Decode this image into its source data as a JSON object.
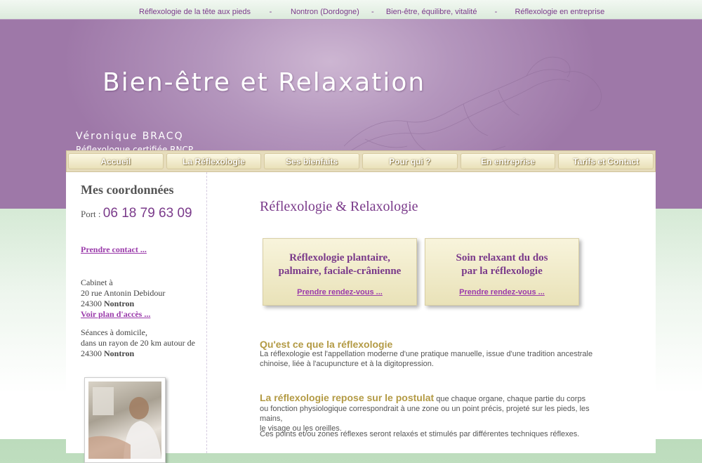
{
  "topnav": [
    {
      "label": "Réflexologie de la tête aux pieds"
    },
    {
      "label": "Nontron (Dordogne)"
    },
    {
      "label": "Bien-être, équilibre, vitalité"
    },
    {
      "label": "Réflexologie en entreprise"
    }
  ],
  "topnav_separator": "-",
  "banner": {
    "title": "Bien-être et Relaxation",
    "name": "Véronique BRACQ",
    "subtitle": "Réflexologue certifiée RNCP"
  },
  "menu": [
    {
      "label": "Accueil"
    },
    {
      "label": "La Réflexologie"
    },
    {
      "label": "Ses bienfaits"
    },
    {
      "label": "Pour qui ?"
    },
    {
      "label": "En entreprise"
    },
    {
      "label": "Tarifs et Contact"
    }
  ],
  "sidebar": {
    "title": "Mes coordonnées",
    "port_label": "Port :",
    "phone": "06 18 79 63 09",
    "contact_link": "Prendre contact ...",
    "address_line1": "Cabinet à",
    "address_line2": "20 rue Antonin Debidour",
    "postcode": "24300",
    "city": "Nontron",
    "map_link": "Voir plan d'accès ...",
    "home_line1": "Séances à domicile,",
    "home_line2": "dans un rayon de 20 km autour de",
    "home_postcode": "24300",
    "home_city": "Nontron"
  },
  "main": {
    "title": "Réflexologie & Relaxologie",
    "cards": [
      {
        "line1": "Réflexologie plantaire,",
        "line2": "palmaire, faciale-crânienne",
        "link": "Prendre rendez-vous ..."
      },
      {
        "line1": "Soin relaxant du dos",
        "line2": "par la réflexologie",
        "link": "Prendre rendez-vous ..."
      }
    ],
    "section1": {
      "heading": "Qu'est ce que la réflexologie",
      "text_line1": "La réflexologie est l'appellation moderne d'une pratique manuelle, issue d'une tradition ancestrale",
      "text_line2": "chinoise, liée à l'acupuncture et à la digitopression."
    },
    "section2": {
      "heading": "La réflexologie repose sur le postulat",
      "text_line1": " que chaque organe, chaque partie du corps",
      "text_line2": "ou fonction physiologique correspondrait à une zone ou un point précis, projeté sur les pieds, les mains,",
      "text_line3": "le visage ou les oreilles."
    },
    "section3": {
      "text": "Ces points et/ou zones réflexes seront relaxés et stimulés par différentes techniques réflexes."
    }
  },
  "colors": {
    "accent_purple": "#7a3a8a",
    "link_purple": "#9a3aaa",
    "heading_gold": "#b39a44",
    "banner_purple": "#9e78a8",
    "menu_beige": "#e6dcbc"
  }
}
